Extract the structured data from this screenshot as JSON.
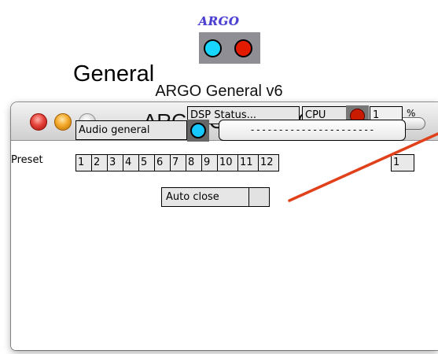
{
  "app_icon": {
    "logo_text": "ARGO",
    "caption": "ARGO General v6",
    "dot_colors": [
      "#17d6ff",
      "#e21b00"
    ]
  },
  "window": {
    "title": "ARGO General v6"
  },
  "panel": {
    "heading": "General",
    "dsp_status_label": "DSP Status...",
    "cpu_label": "CPU",
    "cpu_value": "1",
    "cpu_unit": "%",
    "audio_general_label": "Audio general",
    "dash_field_value": "----------------------",
    "preset_label": "Preset",
    "presets": [
      "1",
      "2",
      "3",
      "4",
      "5",
      "6",
      "7",
      "8",
      "9",
      "10",
      "11",
      "12"
    ],
    "preset_value": "1",
    "auto_close_label": "Auto close"
  },
  "colors": {
    "accent_red": "#e0401a",
    "cpu_led": "#c81b00",
    "audio_led": "#17c8ff"
  }
}
